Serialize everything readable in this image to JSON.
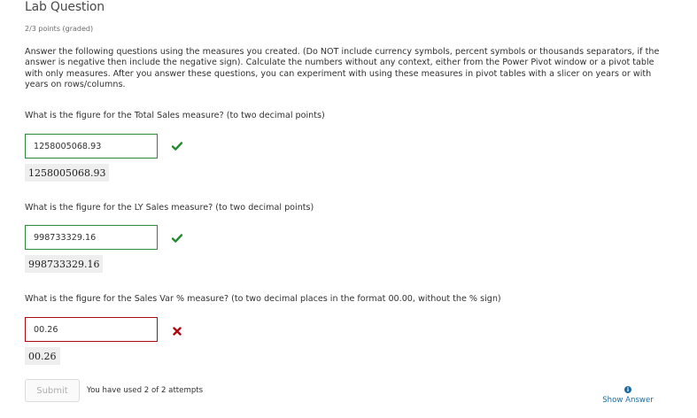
{
  "problem": {
    "title": "Lab Question",
    "points": "2/3 points (graded)",
    "intro": "Answer the following questions using the measures you created. (Do NOT include currency symbols, percent symbols or thousands separators, if the answer is negative then include the negative sign). Calculate the numbers without any context, either from the Power Pivot window or a pivot table with only measures. After you answer these questions, you can experiment with using these measures in pivot tables with a slicer on years or with years on rows/columns."
  },
  "questions": [
    {
      "text": "What is the figure for the Total Sales measure? (to two decimal points)",
      "input_value": "1258005068.93",
      "submitted_answer": "1258005068.93",
      "status": "correct",
      "status_color": "#1e8a2e"
    },
    {
      "text": "What is the figure for the LY Sales measure? (to two decimal points)",
      "input_value": "998733329.16",
      "submitted_answer": "998733329.16",
      "status": "correct",
      "status_color": "#1e8a2e"
    },
    {
      "text": "What is the figure for the Sales Var % measure? (to two decimal places in the format 00.00, without the % sign)",
      "input_value": "00.26",
      "submitted_answer": "00.26",
      "status": "incorrect",
      "status_color": "#b20610"
    }
  ],
  "footer": {
    "submit_label": "Submit",
    "attempts_text": "You have used 2 of 2 attempts",
    "show_answer_label": "Show Answer",
    "show_answer_icon": "info-icon"
  }
}
